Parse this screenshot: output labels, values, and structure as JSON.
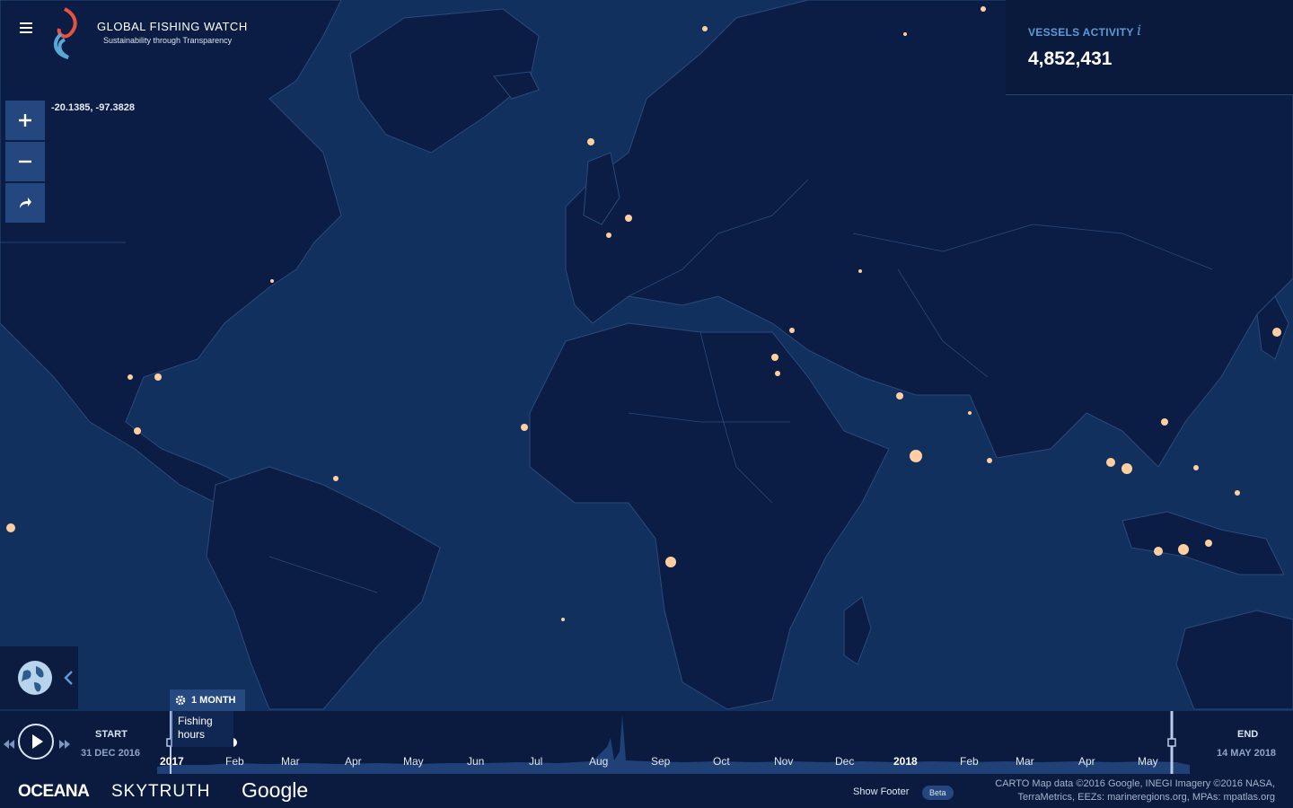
{
  "header": {
    "title": "GLOBAL FISHING WATCH",
    "subtitle": "Sustainability through Transparency"
  },
  "map": {
    "coordinates": "-20.1385, -97.3828",
    "colors": {
      "ocean": "#12305e",
      "land": "#0b1d44",
      "border": "#2a4a7c",
      "hotspot": "#ffcf9f"
    }
  },
  "controls": {
    "zoom_in": "+",
    "zoom_out": "−",
    "share_icon": "share-arrow-icon"
  },
  "vessels": {
    "label": "VESSELS ACTIVITY",
    "info": "i",
    "count": "4,852,431"
  },
  "timebar": {
    "period": "1 MONTH",
    "layer_label": "Fishing hours",
    "start_label": "START",
    "start_date": "31 DEC 2016",
    "end_label": "END",
    "end_date": "14 MAY 2018",
    "months": [
      {
        "label": "2017",
        "year": true
      },
      {
        "label": "Feb"
      },
      {
        "label": "Mar"
      },
      {
        "label": "Apr"
      },
      {
        "label": "May"
      },
      {
        "label": "Jun"
      },
      {
        "label": "Jul"
      },
      {
        "label": "Aug"
      },
      {
        "label": "Sep"
      },
      {
        "label": "Oct"
      },
      {
        "label": "Nov"
      },
      {
        "label": "Dec"
      },
      {
        "label": "2018",
        "year": true
      },
      {
        "label": "Feb"
      },
      {
        "label": "Mar"
      },
      {
        "label": "Apr"
      },
      {
        "label": "May"
      }
    ]
  },
  "footer": {
    "partners": [
      "OCEANA",
      "SKYTRUTH",
      "Google"
    ],
    "show_footer": "Show Footer",
    "beta": "Beta",
    "credits_line1": "CARTO Map data ©2016 Google, INEGI Imagery ©2016 NASA,",
    "credits_line2": "TerraMetrics, EEZs: marineregions.org, MPAs: mpatlas.org"
  }
}
